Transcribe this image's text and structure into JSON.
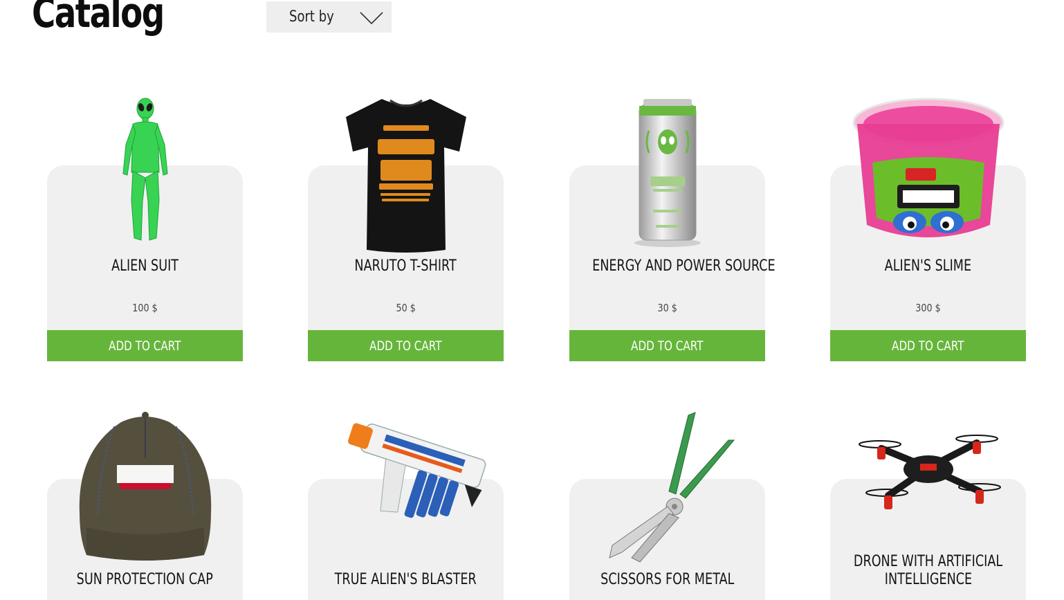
{
  "header": {
    "title": "Catalog",
    "sort_label": "Sort by"
  },
  "products": [
    {
      "name": "ALIEN SUIT",
      "price": "100 $",
      "cta": "ADD TO CART",
      "image": "green-bodysuit"
    },
    {
      "name": "NARUTO T-SHIRT",
      "price": "50 $",
      "cta": "ADD TO CART",
      "image": "black-tshirt"
    },
    {
      "name": "ENERGY AND POWER SOURCE",
      "price": "30 $",
      "cta": "ADD TO CART",
      "image": "energy-drink-can"
    },
    {
      "name": "ALIEN'S SLIME",
      "price": "300 $",
      "cta": "ADD TO CART",
      "image": "slime-bucket"
    },
    {
      "name": "SUN PROTECTION CAP",
      "image": "area51-cap"
    },
    {
      "name": "TRUE ALIEN'S BLASTER",
      "image": "toy-blaster"
    },
    {
      "name": "SCISSORS FOR METAL",
      "image": "metal-snips"
    },
    {
      "name_line1": "DRONE WITH ARTIFICIAL",
      "name_line2": "INTELLIGENCE",
      "image": "quadcopter-drone"
    }
  ],
  "colors": {
    "accent": "#66b53b",
    "card_bg": "#f0f0f0",
    "sort_bg": "#eeeeee"
  }
}
